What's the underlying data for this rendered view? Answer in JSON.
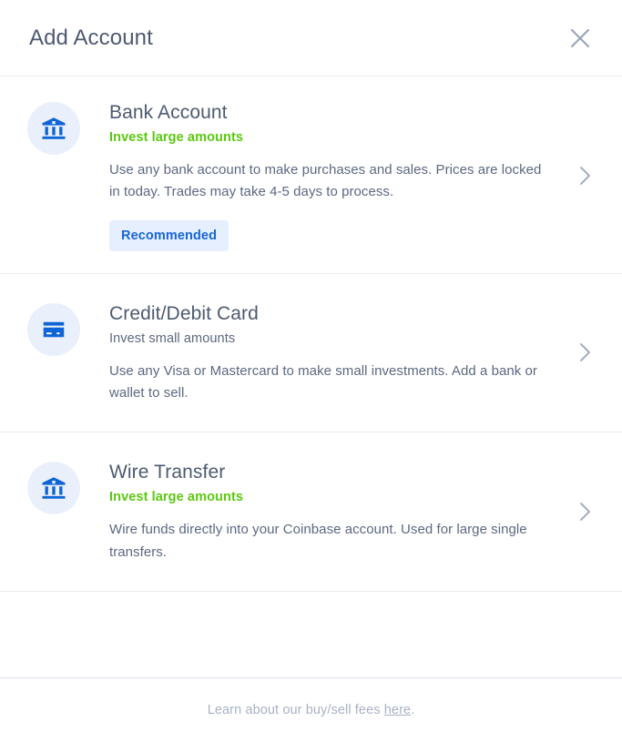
{
  "header": {
    "title": "Add Account",
    "close_icon": "close-icon"
  },
  "colors": {
    "accent_blue": "#1565d8",
    "icon_blue": "#0f65d6",
    "icon_circle_bg": "#e9f0fb",
    "green": "#5cc811",
    "title_slate": "#4e5a70",
    "body_gray": "#5c6880",
    "footer_gray": "#a8b2c4",
    "divider": "#e8ecf1",
    "badge_bg": "#e6efff"
  },
  "options": [
    {
      "id": "bank-account",
      "icon": "bank-icon",
      "title": "Bank Account",
      "subtitle": "Invest large amounts",
      "subtitle_style": "green",
      "description": "Use any bank account to make purchases and sales. Prices are locked in today. Trades may take 4-5 days to process.",
      "badge": "Recommended",
      "chevron": "chevron-right-icon"
    },
    {
      "id": "credit-debit-card",
      "icon": "credit-card-icon",
      "title": "Credit/Debit Card",
      "subtitle": "Invest small amounts",
      "subtitle_style": "gray",
      "description": "Use any Visa or Mastercard to make small investments. Add a bank or wallet to sell.",
      "badge": null,
      "chevron": "chevron-right-icon"
    },
    {
      "id": "wire-transfer",
      "icon": "bank-icon",
      "title": "Wire Transfer",
      "subtitle": "Invest large amounts",
      "subtitle_style": "green",
      "description": "Wire funds directly into your Coinbase account. Used for large single transfers.",
      "badge": null,
      "chevron": "chevron-right-icon"
    }
  ],
  "footer": {
    "text_before": "Learn about our buy/sell fees ",
    "link_label": "here",
    "text_after": "."
  }
}
